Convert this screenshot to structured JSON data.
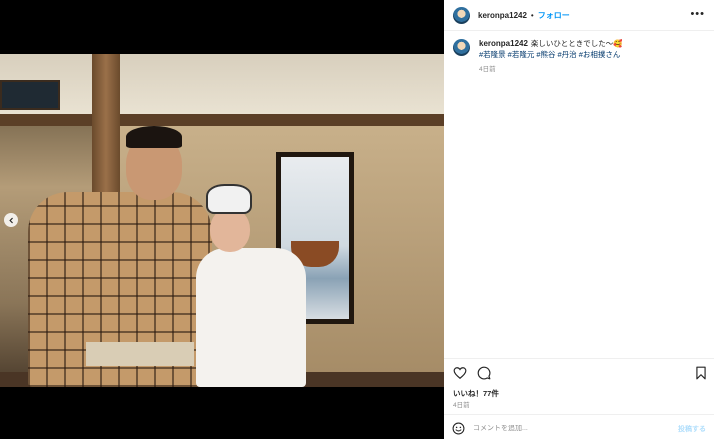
{
  "post": {
    "username": "keronpa1242",
    "separator": "•",
    "follow_label": "フォロー",
    "more_icon": "more-horizontal-icon",
    "caption_text": "楽しいひとときでした〜",
    "caption_emoji": "🥰",
    "hashtags": [
      "#若隆景",
      "#若隆元",
      "#熊谷",
      "#丹治",
      "#お相撲さん"
    ],
    "caption_time": "4日前",
    "likes_label": "いいね！77件",
    "post_time": "4日前"
  },
  "media": {
    "prev_icon": "chevron-left-icon"
  },
  "comment": {
    "placeholder": "コメントを追加...",
    "post_label": "投稿する"
  },
  "colors": {
    "link_blue": "#0095f6",
    "hashtag": "#00376b",
    "muted": "#8e8e8e",
    "post_disabled": "#b2dffc"
  }
}
